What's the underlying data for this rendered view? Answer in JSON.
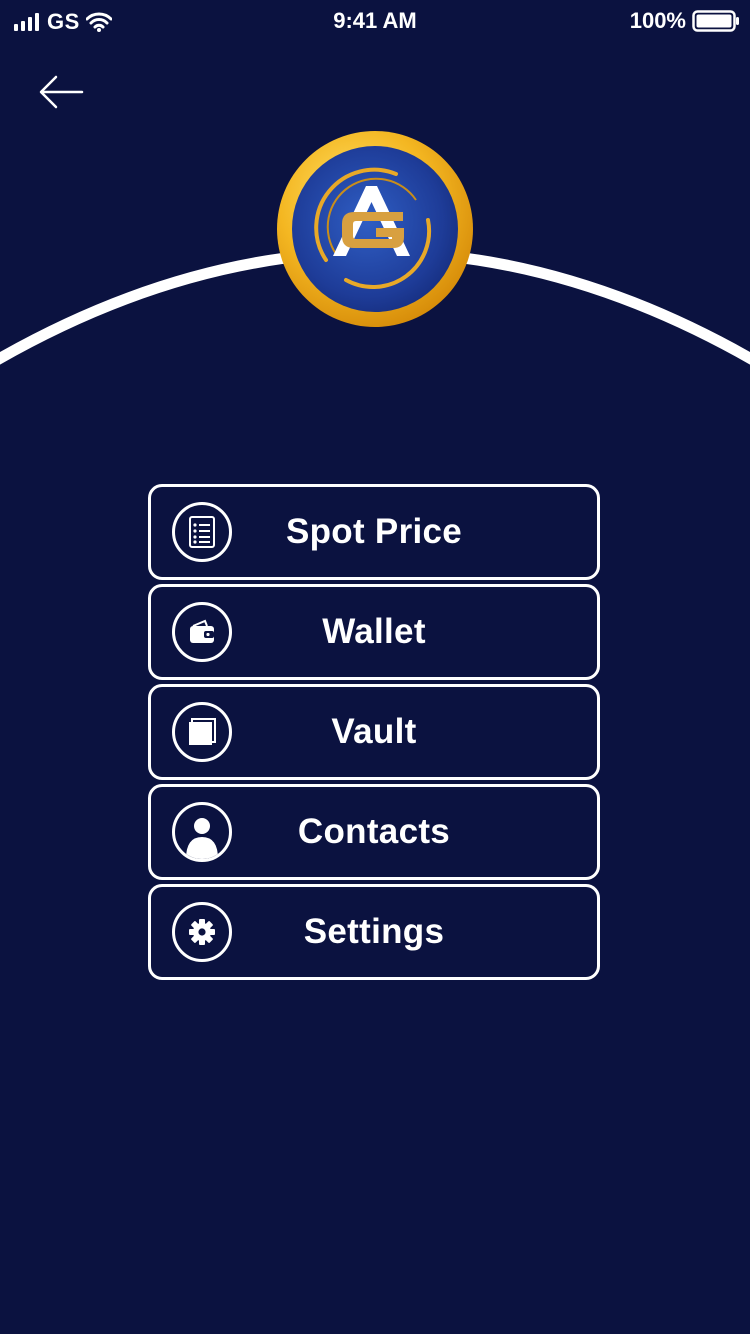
{
  "status_bar": {
    "carrier": "GS",
    "time": "9:41 AM",
    "battery": "100%"
  },
  "colors": {
    "background": "#0b1240",
    "foreground": "#ffffff",
    "gold": "#f0b21a",
    "logo_blue": "#2345a8"
  },
  "logo": {
    "text": "AG"
  },
  "menu": {
    "items": [
      {
        "label": "Spot Price",
        "icon": "list-document-icon"
      },
      {
        "label": "Wallet",
        "icon": "wallet-icon"
      },
      {
        "label": "Vault",
        "icon": "vault-icon"
      },
      {
        "label": "Contacts",
        "icon": "user-icon"
      },
      {
        "label": "Settings",
        "icon": "gear-icon"
      }
    ]
  }
}
